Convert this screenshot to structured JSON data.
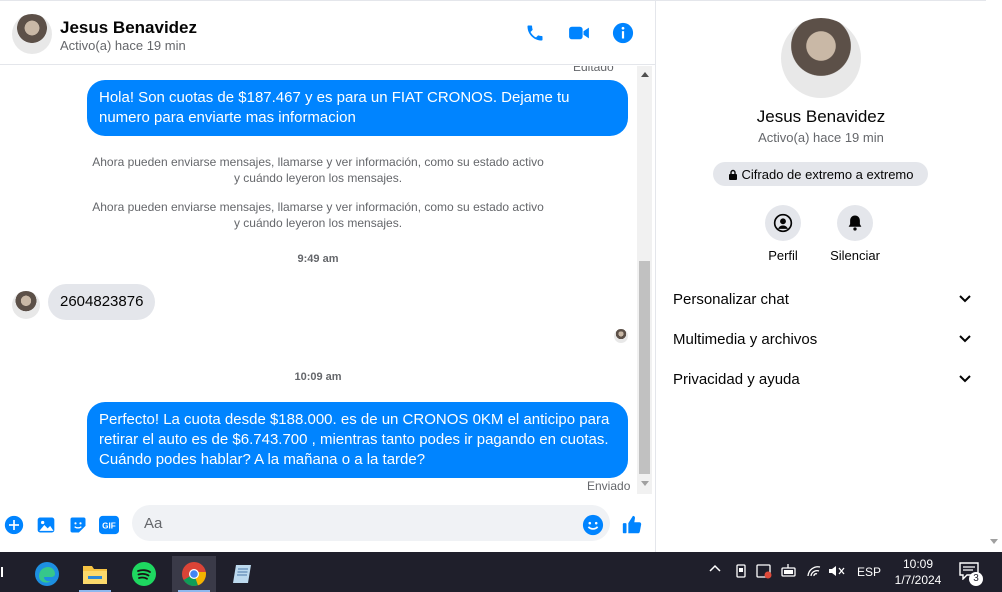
{
  "contact": {
    "name": "Jesus Benavidez",
    "status": "Activo(a) hace 19 min"
  },
  "messages": {
    "edited_label": "Editado",
    "out1": "Hola! Son cuotas de $187.467 y es para un FIAT CRONOS. Dejame tu numero para enviarte mas informacion",
    "sys1": "Ahora pueden enviarse mensajes, llamarse y ver información, como su estado activo y cuándo leyeron los mensajes.",
    "sys2": "Ahora pueden enviarse mensajes, llamarse y ver información, como su estado activo y cuándo leyeron los mensajes.",
    "time1": "9:49 am",
    "in1": "2604823876",
    "time2": "10:09 am",
    "out2": "Perfecto! La cuota desde $188.000. es de un CRONOS 0KM el anticipo para retirar el auto es de $6.743.700 , mientras tanto podes ir pagando en cuotas. Cuándo podes hablar? A la mañana o a la tarde?",
    "sent_label": "Enviado"
  },
  "composer": {
    "placeholder": "Aa"
  },
  "info": {
    "e2e": "Cifrado de extremo a extremo",
    "profile_label": "Perfil",
    "mute_label": "Silenciar",
    "rows": [
      "Personalizar chat",
      "Multimedia y archivos",
      "Privacidad y ayuda"
    ]
  },
  "taskbar": {
    "lang": "ESP",
    "time": "10:09",
    "date": "1/7/2024",
    "notif_count": "3"
  },
  "colors": {
    "accent": "#0084ff",
    "bubble_in": "#e4e6eb",
    "taskbar": "#1f1f2b"
  }
}
